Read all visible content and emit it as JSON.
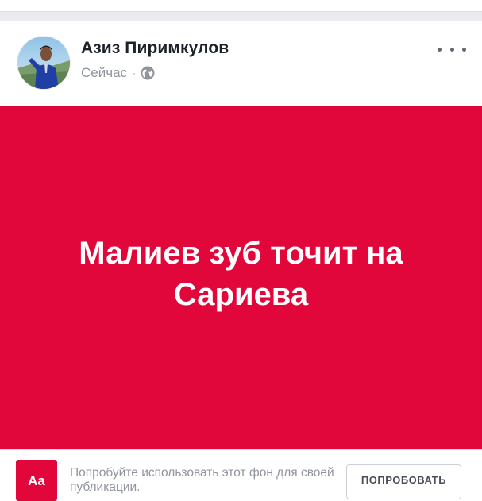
{
  "post": {
    "author_name": "Азиз Пиримкулов",
    "timestamp": "Сейчас",
    "separator": "·",
    "privacy_icon": "globe-icon",
    "more_icon": "more-horizontal-icon",
    "text": "Малиев зуб точит на Сариева",
    "background_color": "#e1073a"
  },
  "composer_hint": {
    "icon_label": "Aa",
    "text": "Попробуйте использовать этот фон для своей публикации.",
    "button_label": "ПОПРОБОВАТЬ"
  }
}
